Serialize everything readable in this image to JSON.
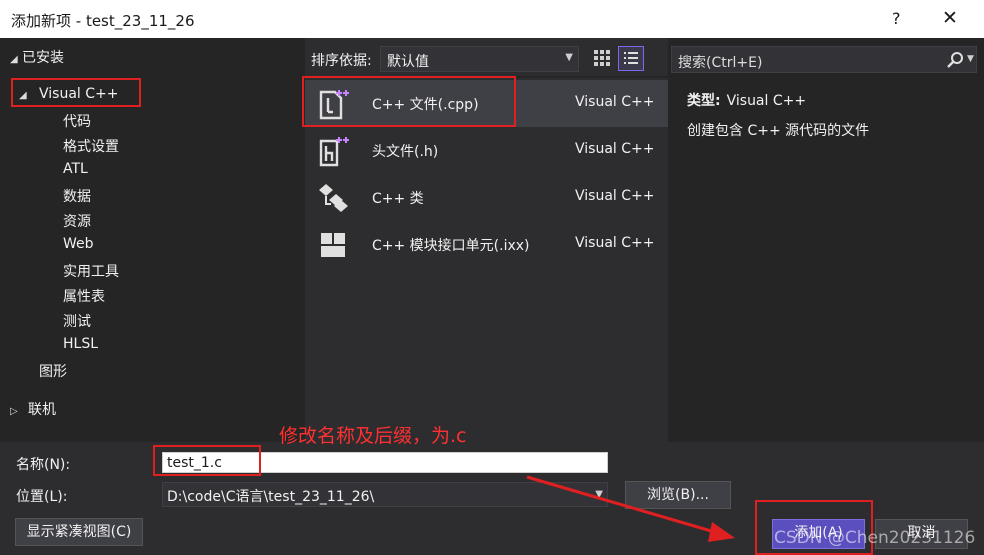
{
  "window": {
    "title": "添加新项 - test_23_11_26",
    "help": "?",
    "close": "✕"
  },
  "tree": {
    "installed": "已安装",
    "visual_cpp": "Visual C++",
    "children": [
      "代码",
      "格式设置",
      "ATL",
      "数据",
      "资源",
      "Web",
      "实用工具",
      "属性表",
      "测试",
      "HLSL"
    ],
    "graphics": "图形",
    "online": "联机"
  },
  "sort": {
    "label": "排序依据:",
    "value": "默认值"
  },
  "templates": [
    {
      "name": "C++ 文件(.cpp)",
      "lang": "Visual C++"
    },
    {
      "name": "头文件(.h)",
      "lang": "Visual C++"
    },
    {
      "name": "C++ 类",
      "lang": "Visual C++"
    },
    {
      "name": "C++ 模块接口单元(.ixx)",
      "lang": "Visual C++"
    }
  ],
  "search": {
    "placeholder": "搜索(Ctrl+E)"
  },
  "details": {
    "type_label": "类型:",
    "type_value": "Visual C++",
    "description": "创建包含 C++ 源代码的文件"
  },
  "form": {
    "name_label": "名称(N):",
    "name_value": "test_1.c",
    "location_label": "位置(L):",
    "location_value": "D:\\code\\C语言\\test_23_11_26\\",
    "browse_label": "浏览(B)...",
    "compact_label": "显示紧凑视图(C)",
    "add_label": "添加(A)",
    "cancel_label": "取消"
  },
  "annotation": "修改名称及后缀，为.c",
  "watermark": "CSDN @Chen20231126",
  "colors": {
    "accent": "#7b68ee",
    "annotation": "#e02020",
    "icon_plus": "#c586ff"
  }
}
